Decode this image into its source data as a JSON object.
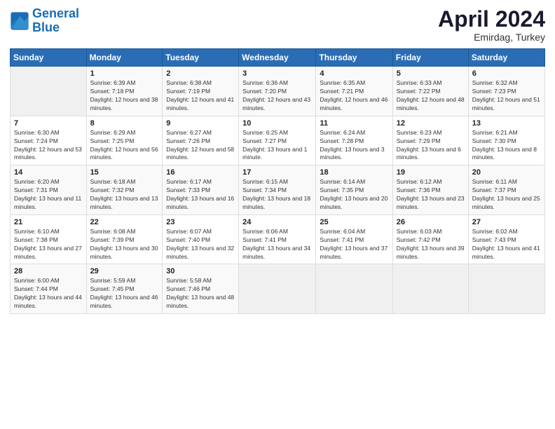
{
  "header": {
    "logo_line1": "General",
    "logo_line2": "Blue",
    "month": "April 2024",
    "location": "Emirdag, Turkey"
  },
  "weekdays": [
    "Sunday",
    "Monday",
    "Tuesday",
    "Wednesday",
    "Thursday",
    "Friday",
    "Saturday"
  ],
  "weeks": [
    [
      {
        "day": "",
        "sunrise": "",
        "sunset": "",
        "daylight": ""
      },
      {
        "day": "1",
        "sunrise": "Sunrise: 6:39 AM",
        "sunset": "Sunset: 7:18 PM",
        "daylight": "Daylight: 12 hours and 38 minutes."
      },
      {
        "day": "2",
        "sunrise": "Sunrise: 6:38 AM",
        "sunset": "Sunset: 7:19 PM",
        "daylight": "Daylight: 12 hours and 41 minutes."
      },
      {
        "day": "3",
        "sunrise": "Sunrise: 6:36 AM",
        "sunset": "Sunset: 7:20 PM",
        "daylight": "Daylight: 12 hours and 43 minutes."
      },
      {
        "day": "4",
        "sunrise": "Sunrise: 6:35 AM",
        "sunset": "Sunset: 7:21 PM",
        "daylight": "Daylight: 12 hours and 46 minutes."
      },
      {
        "day": "5",
        "sunrise": "Sunrise: 6:33 AM",
        "sunset": "Sunset: 7:22 PM",
        "daylight": "Daylight: 12 hours and 48 minutes."
      },
      {
        "day": "6",
        "sunrise": "Sunrise: 6:32 AM",
        "sunset": "Sunset: 7:23 PM",
        "daylight": "Daylight: 12 hours and 51 minutes."
      }
    ],
    [
      {
        "day": "7",
        "sunrise": "Sunrise: 6:30 AM",
        "sunset": "Sunset: 7:24 PM",
        "daylight": "Daylight: 12 hours and 53 minutes."
      },
      {
        "day": "8",
        "sunrise": "Sunrise: 6:29 AM",
        "sunset": "Sunset: 7:25 PM",
        "daylight": "Daylight: 12 hours and 56 minutes."
      },
      {
        "day": "9",
        "sunrise": "Sunrise: 6:27 AM",
        "sunset": "Sunset: 7:26 PM",
        "daylight": "Daylight: 12 hours and 58 minutes."
      },
      {
        "day": "10",
        "sunrise": "Sunrise: 6:25 AM",
        "sunset": "Sunset: 7:27 PM",
        "daylight": "Daylight: 13 hours and 1 minute."
      },
      {
        "day": "11",
        "sunrise": "Sunrise: 6:24 AM",
        "sunset": "Sunset: 7:28 PM",
        "daylight": "Daylight: 13 hours and 3 minutes."
      },
      {
        "day": "12",
        "sunrise": "Sunrise: 6:23 AM",
        "sunset": "Sunset: 7:29 PM",
        "daylight": "Daylight: 13 hours and 6 minutes."
      },
      {
        "day": "13",
        "sunrise": "Sunrise: 6:21 AM",
        "sunset": "Sunset: 7:30 PM",
        "daylight": "Daylight: 13 hours and 8 minutes."
      }
    ],
    [
      {
        "day": "14",
        "sunrise": "Sunrise: 6:20 AM",
        "sunset": "Sunset: 7:31 PM",
        "daylight": "Daylight: 13 hours and 11 minutes."
      },
      {
        "day": "15",
        "sunrise": "Sunrise: 6:18 AM",
        "sunset": "Sunset: 7:32 PM",
        "daylight": "Daylight: 13 hours and 13 minutes."
      },
      {
        "day": "16",
        "sunrise": "Sunrise: 6:17 AM",
        "sunset": "Sunset: 7:33 PM",
        "daylight": "Daylight: 13 hours and 16 minutes."
      },
      {
        "day": "17",
        "sunrise": "Sunrise: 6:15 AM",
        "sunset": "Sunset: 7:34 PM",
        "daylight": "Daylight: 13 hours and 18 minutes."
      },
      {
        "day": "18",
        "sunrise": "Sunrise: 6:14 AM",
        "sunset": "Sunset: 7:35 PM",
        "daylight": "Daylight: 13 hours and 20 minutes."
      },
      {
        "day": "19",
        "sunrise": "Sunrise: 6:12 AM",
        "sunset": "Sunset: 7:36 PM",
        "daylight": "Daylight: 13 hours and 23 minutes."
      },
      {
        "day": "20",
        "sunrise": "Sunrise: 6:11 AM",
        "sunset": "Sunset: 7:37 PM",
        "daylight": "Daylight: 13 hours and 25 minutes."
      }
    ],
    [
      {
        "day": "21",
        "sunrise": "Sunrise: 6:10 AM",
        "sunset": "Sunset: 7:38 PM",
        "daylight": "Daylight: 13 hours and 27 minutes."
      },
      {
        "day": "22",
        "sunrise": "Sunrise: 6:08 AM",
        "sunset": "Sunset: 7:39 PM",
        "daylight": "Daylight: 13 hours and 30 minutes."
      },
      {
        "day": "23",
        "sunrise": "Sunrise: 6:07 AM",
        "sunset": "Sunset: 7:40 PM",
        "daylight": "Daylight: 13 hours and 32 minutes."
      },
      {
        "day": "24",
        "sunrise": "Sunrise: 6:06 AM",
        "sunset": "Sunset: 7:41 PM",
        "daylight": "Daylight: 13 hours and 34 minutes."
      },
      {
        "day": "25",
        "sunrise": "Sunrise: 6:04 AM",
        "sunset": "Sunset: 7:41 PM",
        "daylight": "Daylight: 13 hours and 37 minutes."
      },
      {
        "day": "26",
        "sunrise": "Sunrise: 6:03 AM",
        "sunset": "Sunset: 7:42 PM",
        "daylight": "Daylight: 13 hours and 39 minutes."
      },
      {
        "day": "27",
        "sunrise": "Sunrise: 6:02 AM",
        "sunset": "Sunset: 7:43 PM",
        "daylight": "Daylight: 13 hours and 41 minutes."
      }
    ],
    [
      {
        "day": "28",
        "sunrise": "Sunrise: 6:00 AM",
        "sunset": "Sunset: 7:44 PM",
        "daylight": "Daylight: 13 hours and 44 minutes."
      },
      {
        "day": "29",
        "sunrise": "Sunrise: 5:59 AM",
        "sunset": "Sunset: 7:45 PM",
        "daylight": "Daylight: 13 hours and 46 minutes."
      },
      {
        "day": "30",
        "sunrise": "Sunrise: 5:58 AM",
        "sunset": "Sunset: 7:46 PM",
        "daylight": "Daylight: 13 hours and 48 minutes."
      },
      {
        "day": "",
        "sunrise": "",
        "sunset": "",
        "daylight": ""
      },
      {
        "day": "",
        "sunrise": "",
        "sunset": "",
        "daylight": ""
      },
      {
        "day": "",
        "sunrise": "",
        "sunset": "",
        "daylight": ""
      },
      {
        "day": "",
        "sunrise": "",
        "sunset": "",
        "daylight": ""
      }
    ]
  ]
}
